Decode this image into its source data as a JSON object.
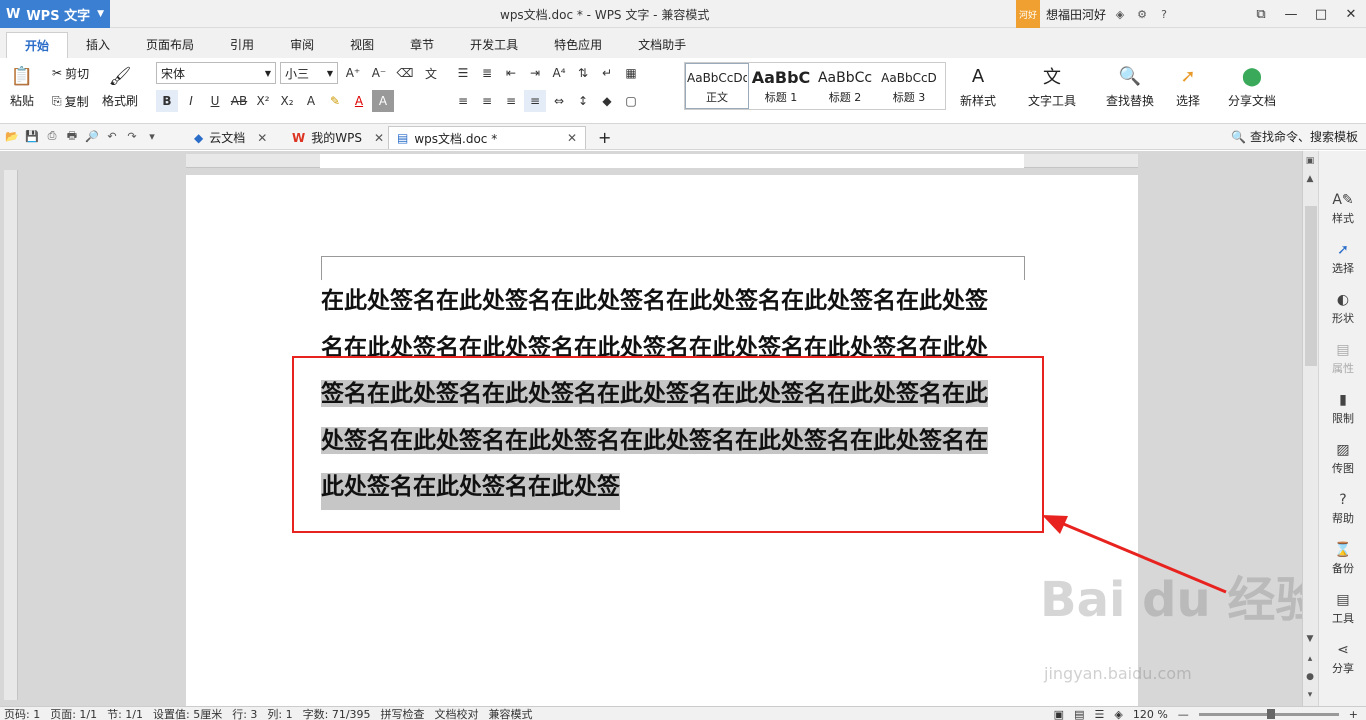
{
  "app": {
    "name": "WPS 文字",
    "title": "wps文档.doc * - WPS 文字 - 兼容模式"
  },
  "user": {
    "badge": "河好",
    "name": "想福田河好"
  },
  "menu_tabs": [
    "开始",
    "插入",
    "页面布局",
    "引用",
    "审阅",
    "视图",
    "章节",
    "开发工具",
    "特色应用",
    "文档助手"
  ],
  "ribbon": {
    "paste": "粘贴",
    "cut": "剪切",
    "copy": "复制",
    "format_painter": "格式刷",
    "font_name": "宋体",
    "font_size": "小三",
    "styles": [
      {
        "sample": "AaBbCcDd",
        "label": "正文"
      },
      {
        "sample": "AaBbC",
        "label": "标题 1"
      },
      {
        "sample": "AaBbCc",
        "label": "标题 2"
      },
      {
        "sample": "AaBbCcD",
        "label": "标题 3"
      }
    ],
    "new_style": "新样式",
    "text_tools": "文字工具",
    "find_replace": "查找替换",
    "select": "选择",
    "share_doc": "分享文档"
  },
  "doc_tabs": [
    "云文档",
    "我的WPS",
    "wps文档.doc *"
  ],
  "search_cmd": "查找命令、搜索模板",
  "document": {
    "lines": [
      "在此处签名在此处签名在此处签名在此处签名在此处签名在此处签",
      "名在此处签名在此处签名在此处签名在此处签名在此处签名在此处",
      "签名在此处签名在此处签名在此处签名在此处签名在此处签名在此",
      "处签名在此处签名在此处签名在此处签名在此处签名在此处签名在",
      "此处签名在此处签名在此处签"
    ]
  },
  "side_panel": [
    "样式",
    "选择",
    "形状",
    "属性",
    "限制",
    "传图",
    "帮助",
    "备份",
    "工具",
    "分享"
  ],
  "status": {
    "page": "页码: 1",
    "pages": "页面: 1/1",
    "section": "节: 1/1",
    "setting": "设置值: 5厘米",
    "row": "行: 3",
    "col": "列: 1",
    "words": "字数: 71/395",
    "spell": "拼写检查",
    "proof": "文档校对",
    "mode": "兼容模式",
    "zoom": "120 %"
  },
  "watermark": {
    "text": "Bai du 经验",
    "url": "jingyan.baidu.com"
  },
  "colors": {
    "accent": "#3b7fd2",
    "highlight_box": "#e8231f",
    "selection": "#c6c6c6"
  }
}
